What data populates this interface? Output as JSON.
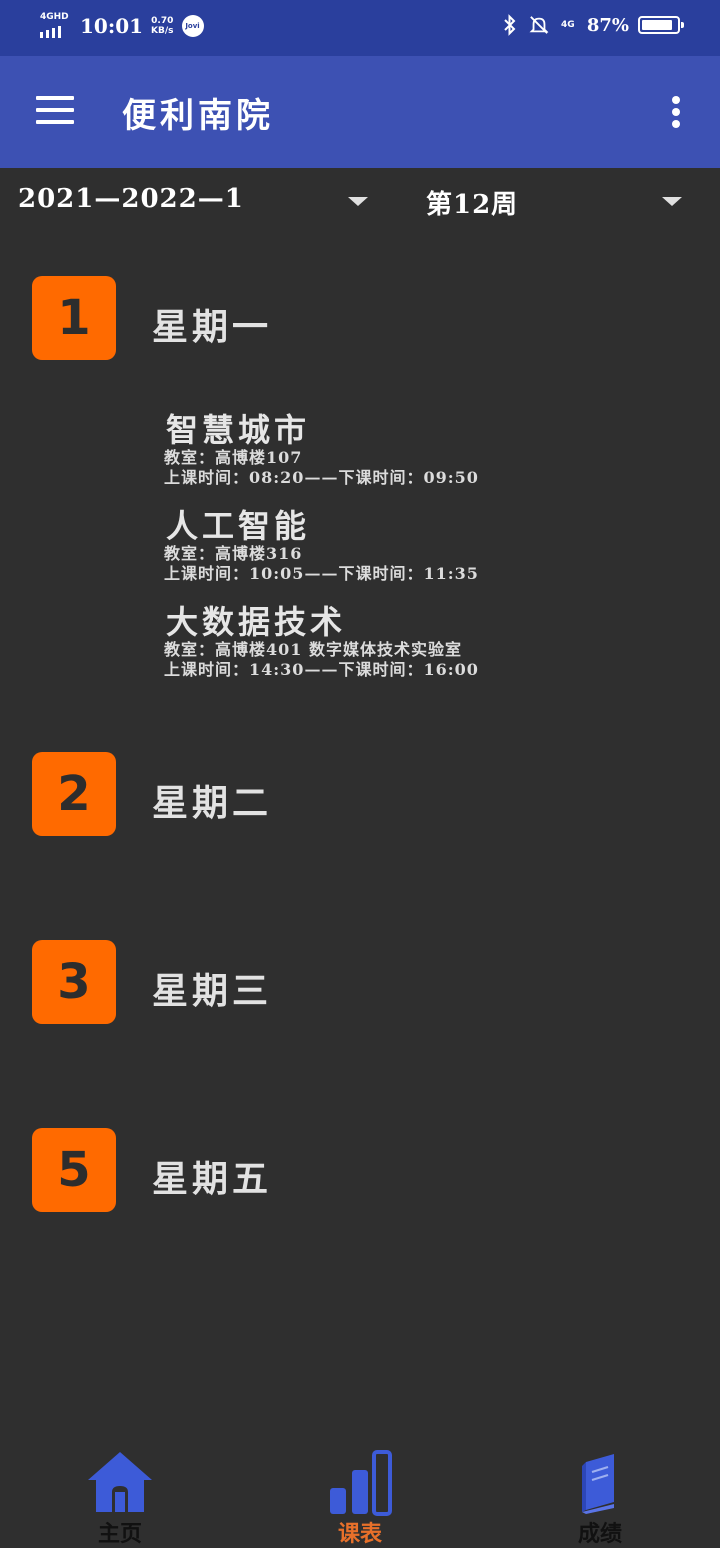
{
  "status_bar": {
    "network": "4GHD",
    "time": "10:01",
    "speed_value": "0.70",
    "speed_unit": "KB/s",
    "jovi": "Jovi",
    "lte": "4G",
    "battery_percent": "87%",
    "battery_level": 0.87
  },
  "appbar": {
    "title": "便利南院"
  },
  "selectors": {
    "term": "2021—2022—1",
    "week": "第12周"
  },
  "days": [
    {
      "number": "1",
      "name": "星期一",
      "courses": [
        {
          "name": "智慧城市",
          "room": "教室：高博楼107",
          "time": "上课时间：08:20——下课时间：09:50"
        },
        {
          "name": "人工智能",
          "room": "教室：高博楼316",
          "time": "上课时间：10:05——下课时间：11:35"
        },
        {
          "name": "大数据技术",
          "room": "教室：高博楼401 数字媒体技术实验室",
          "time": "上课时间：14:30——下课时间：16:00"
        }
      ]
    },
    {
      "number": "2",
      "name": "星期二",
      "courses": []
    },
    {
      "number": "3",
      "name": "星期三",
      "courses": []
    },
    {
      "number": "5",
      "name": "星期五",
      "courses": []
    }
  ],
  "bottom_nav": [
    {
      "label": "主页",
      "icon": "home-icon",
      "color": "#3d5bd8"
    },
    {
      "label": "课表",
      "icon": "bar-chart-icon",
      "color": "#3d5bd8",
      "active": true,
      "active_color": "#e8702a"
    },
    {
      "label": "成绩",
      "icon": "book-icon",
      "color": "#3d5bd8"
    }
  ]
}
